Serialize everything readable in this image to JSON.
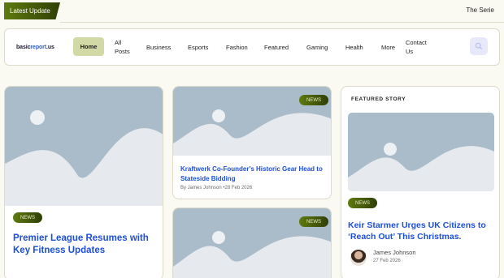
{
  "ticker": {
    "badge": "Latest Update",
    "text": "The Serie"
  },
  "nav": {
    "logo_main": "basic",
    "logo_accent": "report",
    "logo_tail": ".us",
    "items": [
      {
        "line1": "Home",
        "line2": ""
      },
      {
        "line1": "All",
        "line2": "Posts"
      },
      {
        "line1": "Business",
        "line2": ""
      },
      {
        "line1": "Esports",
        "line2": ""
      },
      {
        "line1": "Fashion",
        "line2": ""
      },
      {
        "line1": "Featured",
        "line2": ""
      },
      {
        "line1": "Gaming",
        "line2": ""
      },
      {
        "line1": "Health",
        "line2": ""
      },
      {
        "line1": "More",
        "line2": ""
      },
      {
        "line1": "Contact",
        "line2": "Us"
      }
    ],
    "search_icon": "search-icon"
  },
  "cards": {
    "main": {
      "badge": "NEWS",
      "title": "Premier League Resumes with Key Fitness Updates"
    },
    "mid_top": {
      "badge": "NEWS",
      "title": "Kraftwerk Co-Founder's Historic Gear Head to Stateside Bidding",
      "author": "By James Johnson",
      "date": "28 Feb 2026"
    },
    "mid_bottom": {
      "badge": "NEWS"
    }
  },
  "featured": {
    "label": "FEATURED STORY",
    "badge": "NEWS",
    "title": "Keir Starmer Urges UK Citizens to ‘Reach Out’ This Christmas.",
    "author": "James Johnson",
    "date": "27 Feb 2026"
  },
  "colors": {
    "accent": "#1d4fd8",
    "badge_start": "#5f7a0f",
    "badge_end": "#2f3f06",
    "home_bg": "#d2d8a6"
  }
}
